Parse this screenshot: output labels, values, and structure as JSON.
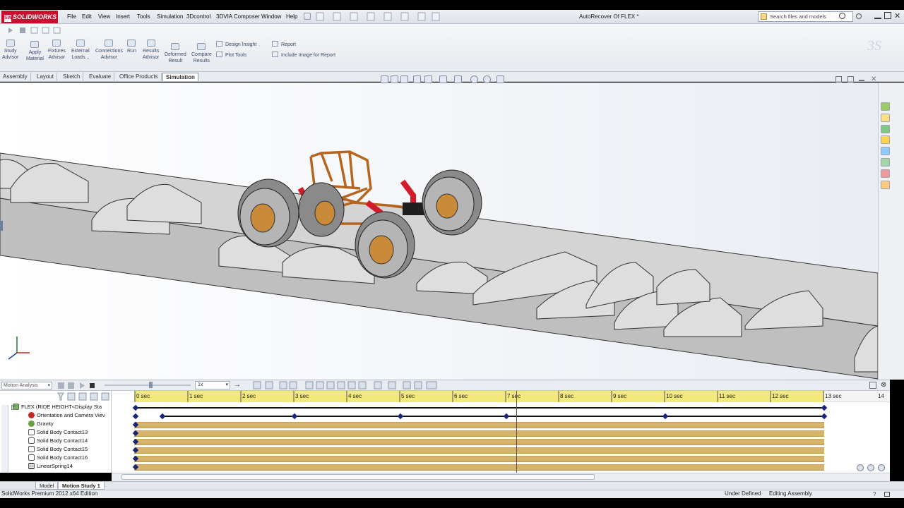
{
  "app": {
    "brand": "SOLIDWORKS",
    "document_title": "AutoRecover Of FLEX *"
  },
  "menu": [
    "File",
    "Edit",
    "View",
    "Insert",
    "Tools",
    "Simulation",
    "3Dcontrol",
    "3DVIA Composer",
    "Window",
    "Help"
  ],
  "search": {
    "placeholder": "Search files and models"
  },
  "ribbon": {
    "buttons": [
      {
        "label": "Study\nAdvisor",
        "icon": "study-advisor-icon"
      },
      {
        "label": "Apply\nMaterial",
        "icon": "apply-material-icon"
      },
      {
        "label": "Fixtures\nAdvisor",
        "icon": "fixtures-advisor-icon"
      },
      {
        "label": "External\nLoads...",
        "icon": "external-loads-icon"
      },
      {
        "label": "Connections\nAdvisor",
        "icon": "connections-advisor-icon"
      },
      {
        "label": "Run",
        "icon": "run-icon"
      },
      {
        "label": "Results\nAdvisor",
        "icon": "results-advisor-icon"
      },
      {
        "label": "Deformed\nResult",
        "icon": "deformed-result-icon"
      },
      {
        "label": "Compare\nResults",
        "icon": "compare-results-icon"
      }
    ],
    "design_insight": "Design Insight",
    "plot_tools": "Plot Tools",
    "report": "Report",
    "include_image": "Include Image for Report"
  },
  "command_tabs": [
    "Assembly",
    "Layout",
    "Sketch",
    "Evaluate",
    "Office Products",
    "Simulation"
  ],
  "active_tab": "Simulation",
  "motion": {
    "study_type": "Motion Analysis",
    "playback_speed": "1x",
    "time_labels": [
      "0 sec",
      "1 sec",
      "2 sec",
      "3 sec",
      "4 sec",
      "5 sec",
      "6 sec",
      "7 sec",
      "8 sec",
      "9 sec",
      "10 sec",
      "11 sec",
      "12 sec",
      "13 sec",
      "14"
    ],
    "tree": [
      {
        "label": "FLEX  (RIDE HEIGHT<Display Sta",
        "icon": "assembly-icon"
      },
      {
        "label": "Orientation and Camera Viev",
        "icon": "camera-views-icon"
      },
      {
        "label": "Gravity",
        "icon": "gravity-icon"
      },
      {
        "label": "Solid Body Contact13",
        "icon": "contact-icon"
      },
      {
        "label": "Solid Body Contact14",
        "icon": "contact-icon"
      },
      {
        "label": "Solid Body Contact15",
        "icon": "contact-icon"
      },
      {
        "label": "Solid Body Contact16",
        "icon": "contact-icon"
      },
      {
        "label": "LinearSpring14",
        "icon": "spring-icon"
      }
    ]
  },
  "bottom_tabs": [
    "Model",
    "Motion Study 1"
  ],
  "status": {
    "left": "SolidWorks Premium 2012 x64 Edition",
    "state": "Under Defined",
    "mode": "Editing Assembly"
  },
  "colors": {
    "brand_red": "#c8102e",
    "timeline_ruler": "#f2e97a",
    "timeline_bar": "#d6b36b",
    "keyframe": "#1a237e"
  }
}
